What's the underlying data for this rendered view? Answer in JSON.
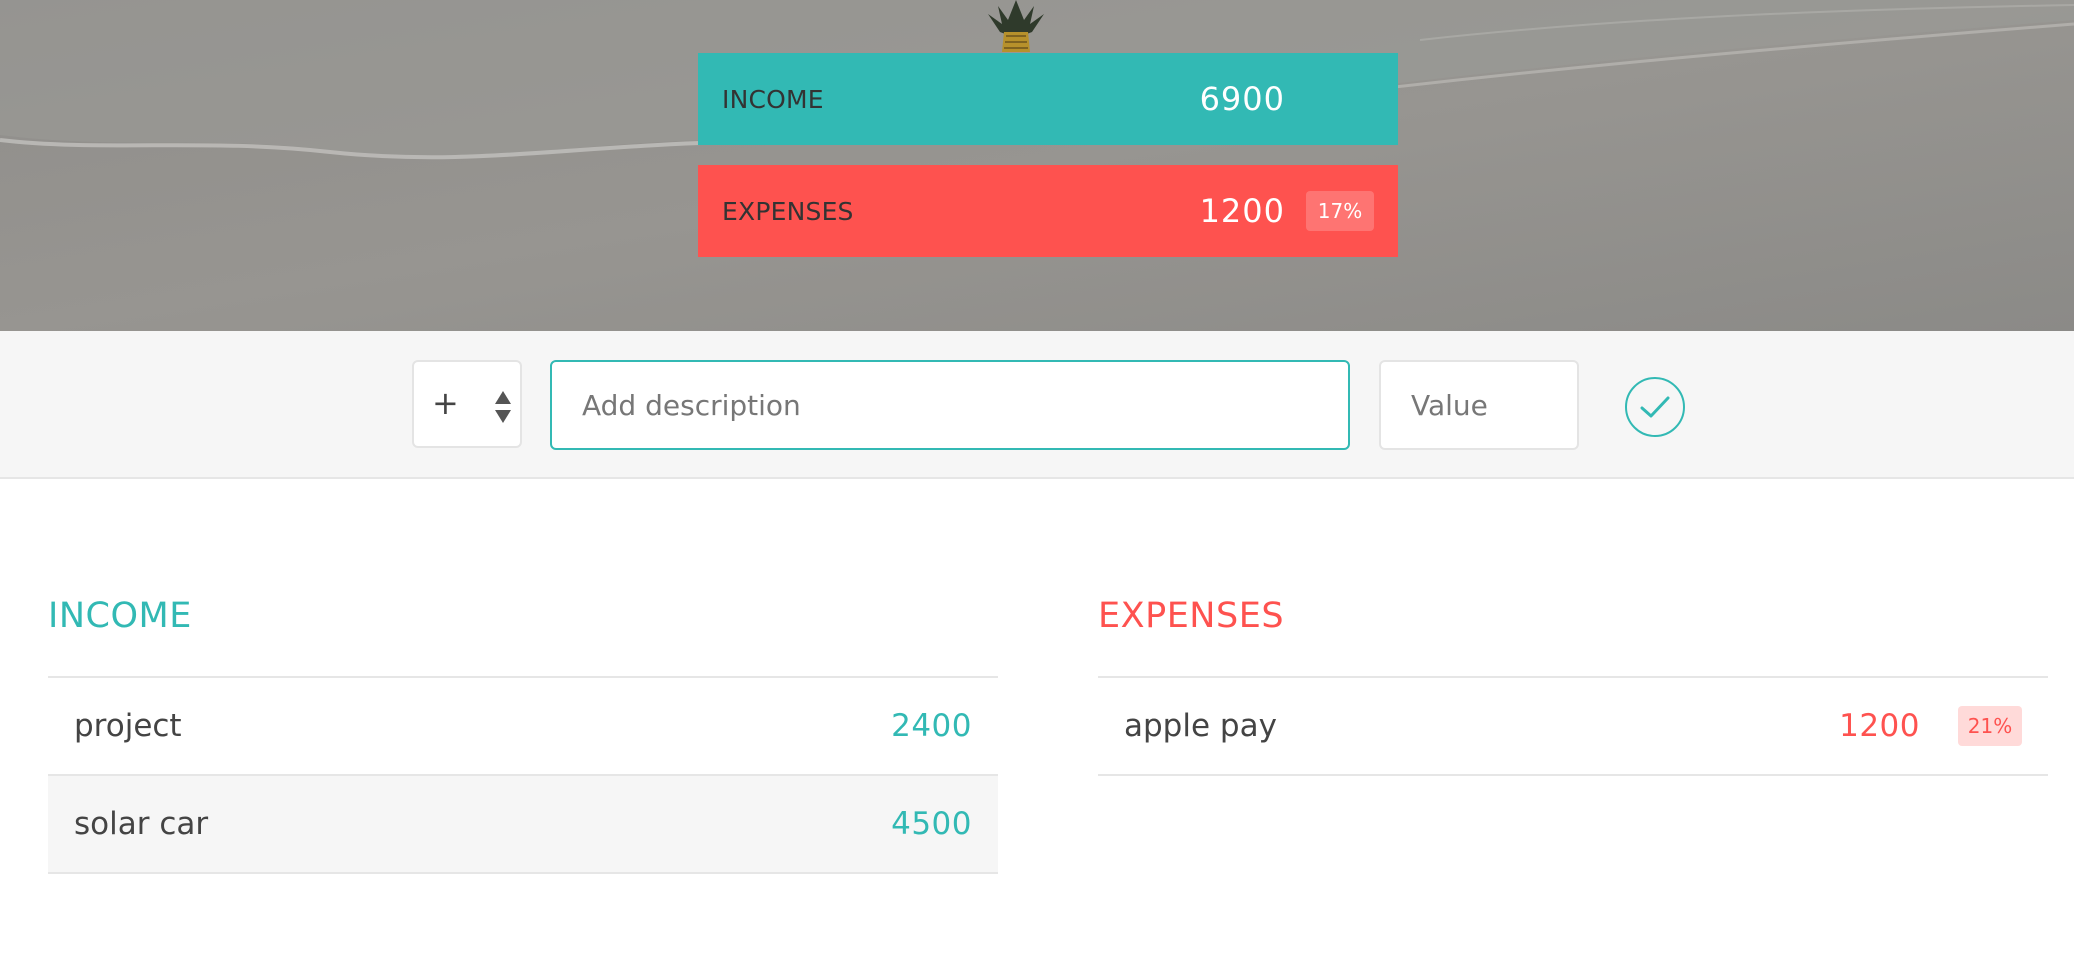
{
  "budget": {
    "income_label": "INCOME",
    "income_value": "6900",
    "expenses_label": "EXPENSES",
    "expenses_value": "1200",
    "expenses_percentage": "17%"
  },
  "add_form": {
    "type_selected": "+",
    "description_placeholder": "Add description",
    "value_placeholder": "Value",
    "submit_icon": "checkmark-icon"
  },
  "income_list": {
    "title": "INCOME",
    "items": [
      {
        "description": "project",
        "value": "2400"
      },
      {
        "description": "solar car",
        "value": "4500"
      }
    ]
  },
  "expenses_list": {
    "title": "EXPENSES",
    "items": [
      {
        "description": "apple pay",
        "value": "1200",
        "percentage": "21%"
      }
    ]
  },
  "colors": {
    "income": "#32b9b4",
    "expenses": "#fe524f",
    "add_bar_background": "#f6f6f6"
  }
}
